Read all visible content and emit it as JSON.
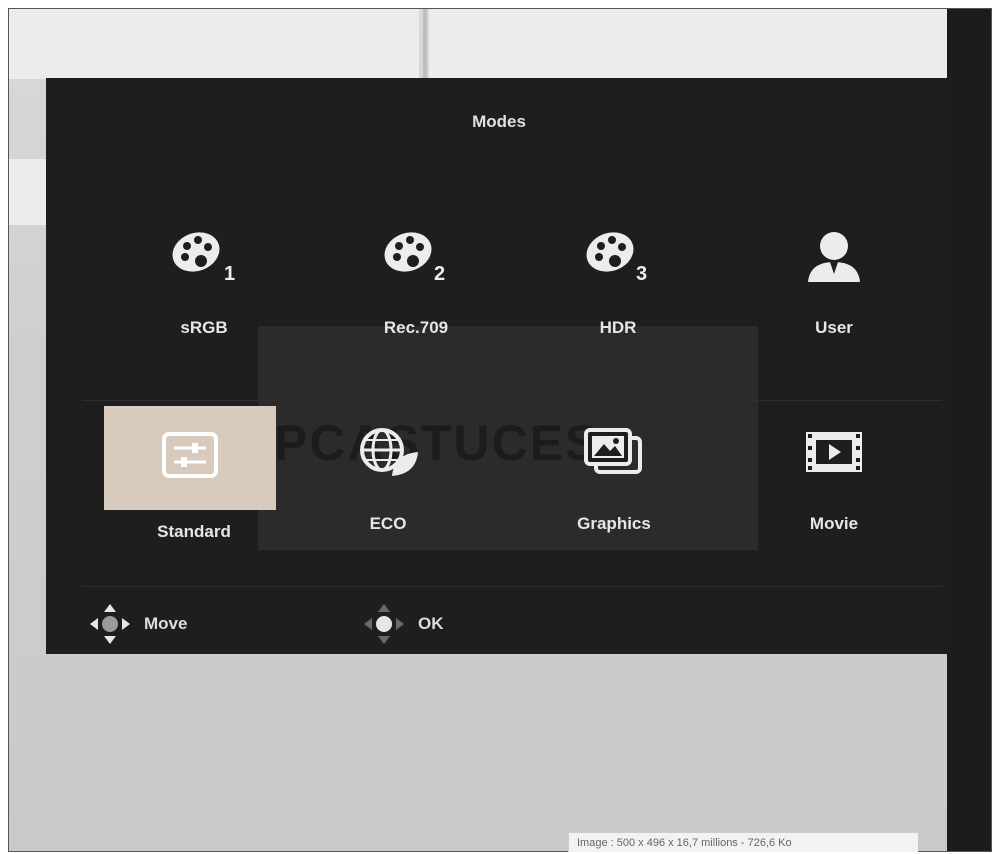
{
  "osd": {
    "title": "Modes",
    "modes": [
      {
        "label": "sRGB",
        "icon": "palette-1-icon"
      },
      {
        "label": "Rec.709",
        "icon": "palette-2-icon"
      },
      {
        "label": "HDR",
        "icon": "palette-3-icon"
      },
      {
        "label": "User",
        "icon": "user-icon"
      },
      {
        "label": "Standard",
        "icon": "sliders-icon",
        "selected": true
      },
      {
        "label": "ECO",
        "icon": "globe-leaf-icon"
      },
      {
        "label": "Graphics",
        "icon": "pictures-icon"
      },
      {
        "label": "Movie",
        "icon": "film-icon"
      }
    ],
    "nav": {
      "move_label": "Move",
      "ok_label": "OK"
    }
  },
  "watermark": "PCASTUCES",
  "status_bar": "Image : 500 x 496 x 16,7 millions - 726,6 Ko",
  "colors": {
    "osd_background": "#1e1e1f",
    "selected_highlight": "#d8cbbd",
    "text": "#e6e6e6"
  }
}
